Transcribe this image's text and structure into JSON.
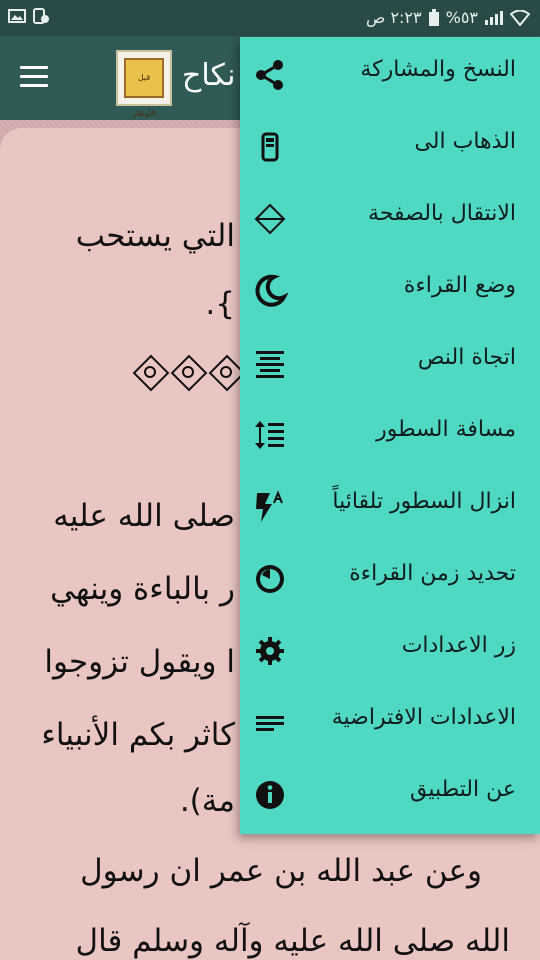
{
  "status_bar": {
    "time": "٢:٢٣ ص",
    "battery": "%٥٣",
    "icons": [
      "battery-icon",
      "signal-icon",
      "wifi-icon",
      "phone-icon",
      "image-icon"
    ]
  },
  "app_bar": {
    "title": "نكاح",
    "logo_text": "قيل الأوطار",
    "menu_icon": "hamburger-icon"
  },
  "content": {
    "lines": [
      "التي يستحب",
      "}.",
      "صلى الله عليه",
      "ر بالباءة وينهي",
      "ا ويقول تزوجوا",
      "كاثر بكم الأنبياء",
      "مة).",
      "وعن عبد الله بن عمر ان رسول",
      "الله صلى الله عليه وآله وسلم قال"
    ]
  },
  "menu": {
    "items": [
      {
        "label": "النسخ والمشاركة",
        "icon": "share-icon"
      },
      {
        "label": "الذهاب الى",
        "icon": "goto-icon"
      },
      {
        "label": "الانتقال بالصفحة",
        "icon": "scroll-arrows-icon"
      },
      {
        "label": "وضع القراءة",
        "icon": "moon-icon"
      },
      {
        "label": "اتجاة النص",
        "icon": "align-center-icon"
      },
      {
        "label": "مسافة السطور",
        "icon": "line-spacing-icon"
      },
      {
        "label": "انزال السطور تلقائياً",
        "icon": "flash-auto-icon"
      },
      {
        "label": "تحديد زمن القراءة",
        "icon": "timer-icon"
      },
      {
        "label": "زر الاعدادات",
        "icon": "gear-icon"
      },
      {
        "label": "الاعدادات الافتراضية",
        "icon": "text-lines-icon"
      },
      {
        "label": "عن التطبيق",
        "icon": "info-icon"
      }
    ]
  }
}
